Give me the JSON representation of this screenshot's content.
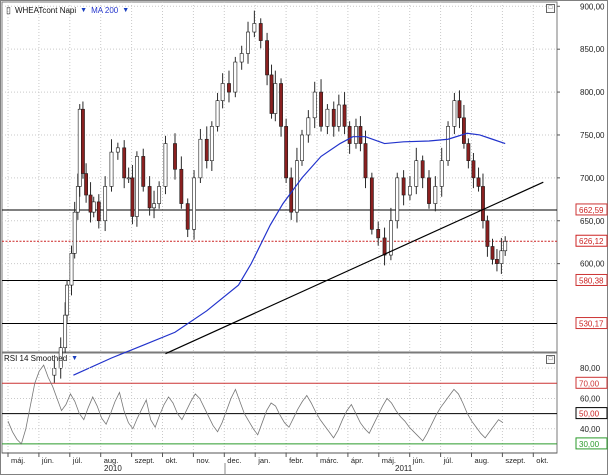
{
  "main_panel": {
    "symbol_icon": "candlestick-icon",
    "symbol_label": "WHEATcont Napi",
    "ma_label": "MA 200"
  },
  "rsi_panel": {
    "label": "RSI 14 Smoothed"
  },
  "colors": {
    "up_candle": "#ffffff",
    "down_candle": "#8a2020",
    "ma_line": "#2233cc",
    "trendline": "#000000",
    "support_line": "#000000",
    "price_line": "#cc2222",
    "rsi_line": "#777777",
    "rsi_70": "#cc3333",
    "rsi_30": "#2a9a2a",
    "grid": "#c9c9c9"
  },
  "chart_data": [
    {
      "type": "candlestick",
      "title": "WHEATcont Napi",
      "series": [
        {
          "name": "WHEATcont Napi",
          "kind": "price",
          "points": [
            {
              "t": 0.0,
              "v": 470
            },
            {
              "t": 0.1,
              "v": 478
            },
            {
              "t": 0.2,
              "v": 502
            },
            {
              "t": 0.27,
              "v": 540
            },
            {
              "t": 0.3,
              "v": 575
            },
            {
              "t": 0.37,
              "v": 612
            },
            {
              "t": 0.42,
              "v": 660
            },
            {
              "t": 0.47,
              "v": 690
            },
            {
              "t": 0.5,
              "v": 780
            },
            {
              "t": 0.55,
              "v": 705
            },
            {
              "t": 0.6,
              "v": 680
            },
            {
              "t": 0.67,
              "v": 660
            },
            {
              "t": 0.72,
              "v": 672
            },
            {
              "t": 0.8,
              "v": 650
            },
            {
              "t": 0.9,
              "v": 690
            },
            {
              "t": 1.0,
              "v": 730
            },
            {
              "t": 1.1,
              "v": 735
            },
            {
              "t": 1.2,
              "v": 700
            },
            {
              "t": 1.27,
              "v": 700
            },
            {
              "t": 1.33,
              "v": 655
            },
            {
              "t": 1.4,
              "v": 725
            },
            {
              "t": 1.5,
              "v": 690
            },
            {
              "t": 1.6,
              "v": 665
            },
            {
              "t": 1.67,
              "v": 670
            },
            {
              "t": 1.75,
              "v": 690
            },
            {
              "t": 1.85,
              "v": 740
            },
            {
              "t": 2.0,
              "v": 710
            },
            {
              "t": 2.1,
              "v": 670
            },
            {
              "t": 2.2,
              "v": 640
            },
            {
              "t": 2.3,
              "v": 700
            },
            {
              "t": 2.4,
              "v": 745
            },
            {
              "t": 2.5,
              "v": 720
            },
            {
              "t": 2.58,
              "v": 760
            },
            {
              "t": 2.67,
              "v": 790
            },
            {
              "t": 2.75,
              "v": 810
            },
            {
              "t": 2.85,
              "v": 800
            },
            {
              "t": 2.95,
              "v": 835
            },
            {
              "t": 3.05,
              "v": 845
            },
            {
              "t": 3.15,
              "v": 870
            },
            {
              "t": 3.25,
              "v": 880
            },
            {
              "t": 3.35,
              "v": 860
            },
            {
              "t": 3.45,
              "v": 820
            },
            {
              "t": 3.52,
              "v": 775
            },
            {
              "t": 3.58,
              "v": 810
            },
            {
              "t": 3.67,
              "v": 760
            },
            {
              "t": 3.75,
              "v": 700
            },
            {
              "t": 3.83,
              "v": 660
            },
            {
              "t": 3.92,
              "v": 720
            },
            {
              "t": 4.0,
              "v": 750
            },
            {
              "t": 4.1,
              "v": 770
            },
            {
              "t": 4.2,
              "v": 800
            },
            {
              "t": 4.3,
              "v": 760
            },
            {
              "t": 4.4,
              "v": 780
            },
            {
              "t": 4.5,
              "v": 760
            },
            {
              "t": 4.58,
              "v": 785
            },
            {
              "t": 4.67,
              "v": 760
            },
            {
              "t": 4.75,
              "v": 740
            },
            {
              "t": 4.85,
              "v": 760
            },
            {
              "t": 4.92,
              "v": 740
            },
            {
              "t": 5.0,
              "v": 700
            },
            {
              "t": 5.1,
              "v": 640
            },
            {
              "t": 5.2,
              "v": 630
            },
            {
              "t": 5.3,
              "v": 610
            },
            {
              "t": 5.4,
              "v": 650
            },
            {
              "t": 5.5,
              "v": 700
            },
            {
              "t": 5.6,
              "v": 680
            },
            {
              "t": 5.7,
              "v": 690
            },
            {
              "t": 5.8,
              "v": 720
            },
            {
              "t": 5.9,
              "v": 700
            },
            {
              "t": 6.0,
              "v": 670
            },
            {
              "t": 6.1,
              "v": 690
            },
            {
              "t": 6.2,
              "v": 720
            },
            {
              "t": 6.3,
              "v": 760
            },
            {
              "t": 6.4,
              "v": 790
            },
            {
              "t": 6.48,
              "v": 770
            },
            {
              "t": 6.55,
              "v": 740
            },
            {
              "t": 6.62,
              "v": 720
            },
            {
              "t": 6.7,
              "v": 700
            },
            {
              "t": 6.78,
              "v": 690
            },
            {
              "t": 6.85,
              "v": 650
            },
            {
              "t": 6.92,
              "v": 620
            },
            {
              "t": 7.0,
              "v": 605
            },
            {
              "t": 7.07,
              "v": 600
            },
            {
              "t": 7.14,
              "v": 615
            },
            {
              "t": 7.2,
              "v": 626
            }
          ]
        },
        {
          "name": "MA 200",
          "kind": "ma",
          "points": [
            {
              "t": 0.4,
              "v": 470
            },
            {
              "t": 1.0,
              "v": 490
            },
            {
              "t": 1.5,
              "v": 505
            },
            {
              "t": 2.0,
              "v": 520
            },
            {
              "t": 2.5,
              "v": 545
            },
            {
              "t": 3.0,
              "v": 575
            },
            {
              "t": 3.2,
              "v": 600
            },
            {
              "t": 3.5,
              "v": 645
            },
            {
              "t": 3.7,
              "v": 670
            },
            {
              "t": 4.0,
              "v": 700
            },
            {
              "t": 4.3,
              "v": 725
            },
            {
              "t": 4.6,
              "v": 740
            },
            {
              "t": 4.8,
              "v": 748
            },
            {
              "t": 5.0,
              "v": 748
            },
            {
              "t": 5.3,
              "v": 740
            },
            {
              "t": 5.6,
              "v": 742
            },
            {
              "t": 6.0,
              "v": 743
            },
            {
              "t": 6.3,
              "v": 745
            },
            {
              "t": 6.6,
              "v": 752
            },
            {
              "t": 6.8,
              "v": 750
            },
            {
              "t": 7.0,
              "v": 745
            },
            {
              "t": 7.2,
              "v": 740
            }
          ]
        }
      ],
      "trendline": {
        "from": {
          "t": 1.85,
          "v": 495
        },
        "to": {
          "t": 7.8,
          "v": 695
        }
      },
      "horizontal_levels": [
        {
          "value": 662.59,
          "label": "662,59",
          "style": "solid"
        },
        {
          "value": 626.12,
          "label": "626,12",
          "style": "dotted-red"
        },
        {
          "value": 580.38,
          "label": "580,38",
          "style": "solid"
        },
        {
          "value": 530.17,
          "label": "530,17",
          "style": "solid"
        }
      ],
      "ylim": [
        497,
        905
      ],
      "yticks": [
        900,
        850,
        800,
        750,
        700,
        650,
        600
      ],
      "ytick_labels": [
        "900,00",
        "850,00",
        "800,00",
        "750,00",
        "700,00",
        "650,00",
        "600,00"
      ],
      "xlim": [
        -0.5,
        7.9
      ],
      "xticks": [
        {
          "t": 0.0,
          "label": "máj."
        },
        {
          "t": 1.0,
          "label": "jún."
        },
        {
          "t": 2.0,
          "label": "júl."
        },
        {
          "t": 3.0,
          "label": "aug."
        },
        {
          "t": 4.0,
          "label": "szept."
        },
        {
          "t": 5.0,
          "label": "okt."
        },
        {
          "t": 6.0,
          "label": "nov."
        },
        {
          "t": 7.0,
          "label": "dec."
        },
        {
          "t": 8.0,
          "label": "jan."
        },
        {
          "t": 9.0,
          "label": "febr."
        },
        {
          "t": 10.0,
          "label": "márc."
        },
        {
          "t": 11.0,
          "label": "ápr."
        },
        {
          "t": 12.0,
          "label": "máj."
        },
        {
          "t": 13.0,
          "label": "jún."
        },
        {
          "t": 14.0,
          "label": "júl."
        },
        {
          "t": 15.0,
          "label": "aug."
        },
        {
          "t": 16.0,
          "label": "szept."
        },
        {
          "t": 17.0,
          "label": "okt."
        }
      ],
      "year_labels": [
        {
          "t": 3.5,
          "label": "2010"
        },
        {
          "t": 15.2,
          "label": "2011"
        }
      ],
      "grid": true
    },
    {
      "type": "line",
      "title": "RSI 14 Smoothed",
      "series": [
        {
          "name": "RSI 14 Smoothed",
          "values": [
            45,
            38,
            33,
            30,
            40,
            55,
            70,
            78,
            82,
            74,
            68,
            60,
            52,
            56,
            63,
            58,
            50,
            46,
            54,
            61,
            55,
            47,
            43,
            50,
            58,
            64,
            52,
            44,
            40,
            47,
            53,
            59,
            46,
            41,
            49,
            56,
            61,
            57,
            50,
            46,
            52,
            58,
            63,
            60,
            54,
            48,
            42,
            38,
            44,
            52,
            60,
            66,
            58,
            50,
            45,
            40,
            36,
            44,
            52,
            57,
            55,
            49,
            44,
            41,
            47,
            53,
            58,
            62,
            57,
            51,
            46,
            42,
            38,
            34,
            39,
            46,
            52,
            56,
            50,
            44,
            40,
            37,
            43,
            49,
            55,
            60,
            57,
            52,
            48,
            45,
            41,
            38,
            35,
            32,
            37,
            43,
            49,
            54,
            58,
            62,
            66,
            63,
            57,
            50,
            45,
            41,
            37,
            34,
            38,
            42,
            46,
            44
          ]
        }
      ],
      "levels": [
        {
          "value": 70,
          "label": "70,00",
          "color": "#cc3333"
        },
        {
          "value": 50,
          "label": "50,00",
          "color": "#000000"
        },
        {
          "value": 30,
          "label": "30,00",
          "color": "#2a9a2a"
        }
      ],
      "ylim": [
        24,
        90
      ],
      "yticks": [
        80,
        60,
        40
      ],
      "ytick_labels": [
        "80,00",
        "60,00",
        "40,00"
      ],
      "grid": true
    }
  ]
}
